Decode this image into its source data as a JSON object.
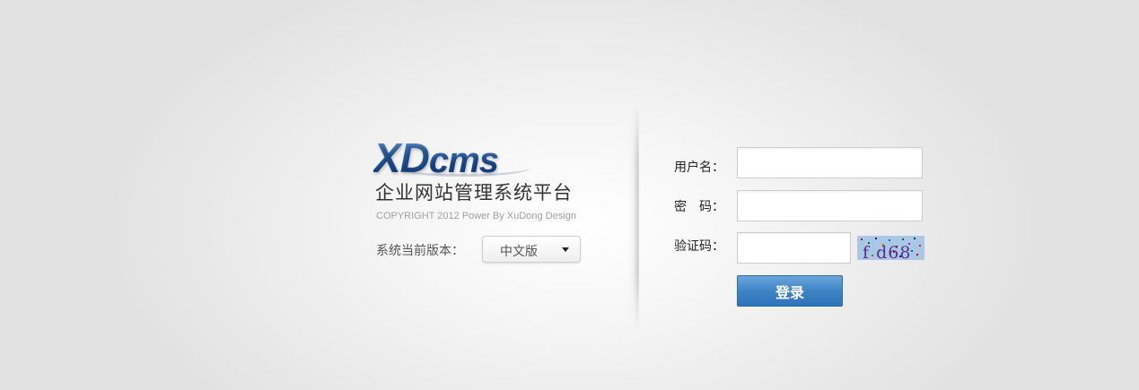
{
  "brand": {
    "logo_xd": "XD",
    "logo_cms": "cms",
    "subtitle": "企业网站管理系统平台",
    "copyright": "COPYRIGHT 2012 Power By XuDong Design"
  },
  "version": {
    "label": "系统当前版本：",
    "selected": "中文版"
  },
  "form": {
    "username_label": "用户名：",
    "username_value": "",
    "password_label": "密　码：",
    "password_value": "",
    "captcha_label": "验证码：",
    "captcha_value": "",
    "captcha_image_text": "f d68",
    "login_button": "登录"
  },
  "colors": {
    "brand_blue": "#1f5aa6",
    "button_blue": "#3f83c6"
  }
}
